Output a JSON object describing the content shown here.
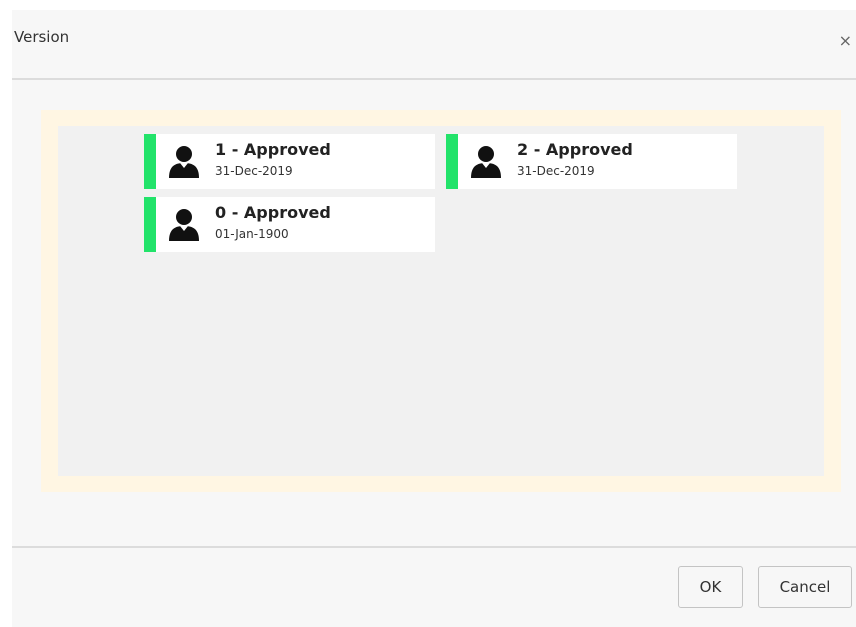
{
  "dialog": {
    "title": "Version",
    "close_icon": "close-icon",
    "close_glyph": "×"
  },
  "versions": [
    {
      "label": "1 - Approved",
      "date": "31-Dec-2019",
      "status_color": "#22e36a",
      "icon": "user-icon"
    },
    {
      "label": "2 - Approved",
      "date": "31-Dec-2019",
      "status_color": "#22e36a",
      "icon": "user-icon"
    },
    {
      "label": "0 - Approved",
      "date": "01-Jan-1900",
      "status_color": "#22e36a",
      "icon": "user-icon"
    }
  ],
  "footer": {
    "ok_label": "OK",
    "cancel_label": "Cancel"
  },
  "colors": {
    "accent_green": "#22e36a",
    "panel_border": "#fff6e3",
    "panel_background": "#f1f1f1"
  }
}
